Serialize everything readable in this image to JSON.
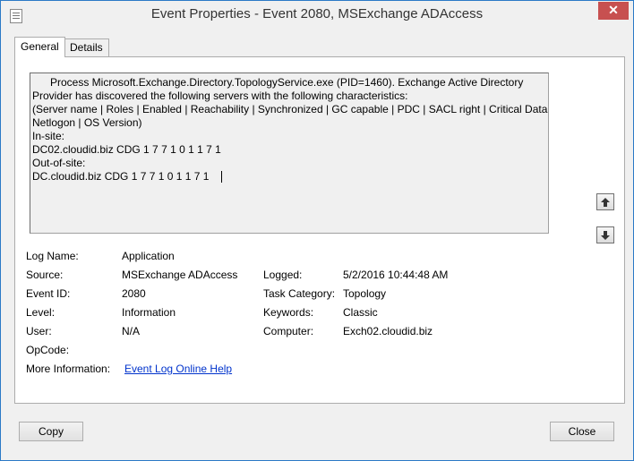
{
  "window": {
    "title": "Event Properties - Event 2080, MSExchange ADAccess",
    "close_symbol": "✕"
  },
  "tabs": [
    {
      "label": "General",
      "active": true
    },
    {
      "label": "Details",
      "active": false
    }
  ],
  "description": {
    "lines": [
      "Process Microsoft.Exchange.Directory.TopologyService.exe (PID=1460). Exchange Active Directory",
      "Provider has discovered the following servers with the following characteristics:",
      " (Server name | Roles | Enabled | Reachability | Synchronized | GC capable | PDC | SACL right | Critical Data |",
      "Netlogon | OS Version)",
      "In-site:",
      "DC02.cloudid.biz  CDG 1 7 7 1 0 1 1 7 1",
      "Out-of-site:",
      "DC.cloudid.biz     CDG 1 7 7 1 0 1 1 7 1"
    ]
  },
  "scroll": {
    "up_icon": "arrow-up-icon",
    "down_icon": "arrow-down-icon"
  },
  "fields": {
    "log_name": {
      "label": "Log Name:",
      "value": "Application"
    },
    "source": {
      "label": "Source:",
      "value": "MSExchange ADAccess"
    },
    "logged": {
      "label": "Logged:",
      "value": "5/2/2016 10:44:48 AM"
    },
    "event_id": {
      "label": "Event ID:",
      "value": "2080"
    },
    "task_category": {
      "label": "Task Category:",
      "value": "Topology"
    },
    "level": {
      "label": "Level:",
      "value": "Information"
    },
    "keywords": {
      "label": "Keywords:",
      "value": "Classic"
    },
    "user": {
      "label": "User:",
      "value": "N/A"
    },
    "computer": {
      "label": "Computer:",
      "value": "Exch02.cloudid.biz"
    },
    "opcode": {
      "label": "OpCode:",
      "value": ""
    },
    "more_info": {
      "label": "More Information:",
      "value": "Event Log Online Help"
    }
  },
  "buttons": {
    "copy": "Copy",
    "close": "Close"
  },
  "colors": {
    "accent": "#2b79c6",
    "link": "#0033cc",
    "close_button": "#c75050"
  }
}
